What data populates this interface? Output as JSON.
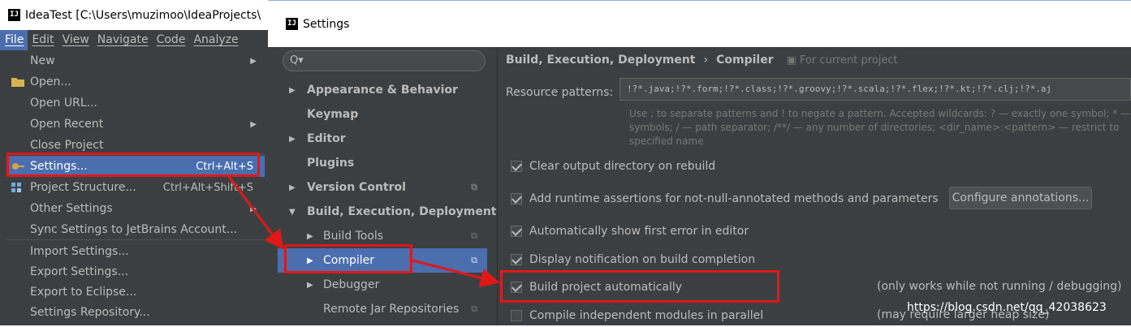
{
  "ide_window": {
    "title": "IdeaTest [C:\\Users\\muzimoo\\IdeaProjects\\",
    "logo": "IJ",
    "menubar": [
      "File",
      "Edit",
      "View",
      "Navigate",
      "Code",
      "Analyze"
    ],
    "file_menu": [
      {
        "label": "New",
        "submenu": true
      },
      {
        "label": "Open...",
        "icon": "folder-icon"
      },
      {
        "label": "Open URL..."
      },
      {
        "label": "Open Recent",
        "submenu": true
      },
      {
        "label": "Close Project"
      },
      {
        "label": "Settings...",
        "shortcut": "Ctrl+Alt+S",
        "icon": "settings-wrench-icon",
        "selected": true
      },
      {
        "label": "Project Structure...",
        "shortcut": "Ctrl+Alt+Shift+S",
        "icon": "project-structure-icon"
      },
      {
        "label": "Other Settings",
        "submenu": true
      },
      {
        "label": "Sync Settings to JetBrains Account..."
      },
      {
        "label": "Import Settings..."
      },
      {
        "label": "Export Settings..."
      },
      {
        "label": "Export to Eclipse..."
      },
      {
        "label": "Settings Repository..."
      }
    ]
  },
  "settings": {
    "title": "Settings",
    "logo": "IJ",
    "search_placeholder": "Q▾",
    "tree": [
      {
        "label": "Appearance & Behavior",
        "arrow": "▶",
        "bold": true
      },
      {
        "label": "Keymap",
        "bold": true
      },
      {
        "label": "Editor",
        "arrow": "▶",
        "bold": true
      },
      {
        "label": "Plugins",
        "bold": true
      },
      {
        "label": "Version Control",
        "arrow": "▶",
        "bold": true,
        "copy_icon": true
      },
      {
        "label": "Build, Execution, Deployment",
        "arrow": "▼",
        "bold": true
      },
      {
        "label": "Build Tools",
        "arrow": "▶",
        "copy_icon": true
      },
      {
        "label": "Compiler",
        "arrow": "▶",
        "copy_icon": true,
        "selected": true
      },
      {
        "label": "Debugger",
        "arrow": "▶"
      },
      {
        "label": "Remote Jar Repositories",
        "copy_icon": true
      }
    ],
    "breadcrumb": {
      "part1": "Build, Execution, Deployment",
      "separator": "›",
      "part2": "Compiler",
      "scope": "For current project"
    },
    "resource_patterns": {
      "label": "Resource patterns:",
      "value": "!?*.java;!?*.form;!?*.class;!?*.groovy;!?*.scala;!?*.flex;!?*.kt;!?*.clj;!?*.aj",
      "help_line1": "Use ; to separate patterns and ! to negate a pattern. Accepted wildcards: ? — exactly one symbol; * —",
      "help_line2": "symbols; / — path separator; /**/ — any number of directories; <dir_name>:<pattern> — restrict to",
      "help_line3": "specified name"
    },
    "options": [
      {
        "label": "Clear output directory on rebuild",
        "checked": true
      },
      {
        "label": "Add runtime assertions for not-null-annotated methods and parameters",
        "checked": true
      },
      {
        "label": "Automatically show first error in editor",
        "checked": true
      },
      {
        "label": "Display notification on build completion",
        "checked": true
      },
      {
        "label": "Build project automatically",
        "checked": true
      },
      {
        "label": "Compile independent modules in parallel",
        "checked": false
      }
    ],
    "configure_button": "Configure annotations...",
    "note_auto_build": "(only works while not running / debugging)",
    "note_parallel": "(may require larger heap size)"
  },
  "watermark": "https://blog.csdn.net/qq_42038623",
  "colors": {
    "darcula_bg": "#3c3f41",
    "selection": "#4b6eaf",
    "annotation_red": "#e01818"
  }
}
